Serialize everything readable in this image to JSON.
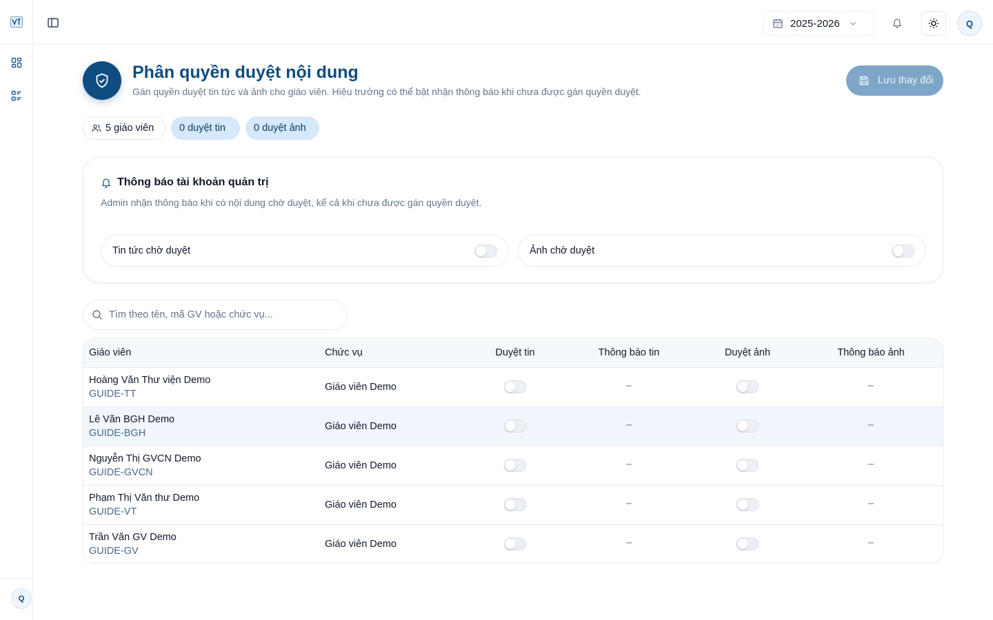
{
  "topbar": {
    "year": "2025-2026",
    "avatar_initial": "Q"
  },
  "sidebar": {
    "avatar_initial": "Q"
  },
  "header": {
    "title": "Phân quyền duyệt nội dung",
    "description": "Gán quyền duyệt tin tức và ảnh cho giáo viên. Hiệu trưởng có thể bật nhận thông báo khi chưa được gán quyền duyệt.",
    "save_label": "Lưu thay đổi"
  },
  "stats": {
    "teachers": "5 giáo viên",
    "news_approvers": "0 duyệt tin",
    "photo_approvers": "0 duyệt ảnh"
  },
  "notifications": {
    "title": "Thông báo tài khoản quản trị",
    "description": "Admin nhận thông báo khi có nội dung chờ duyệt, kể cả khi chưa được gán quyền duyệt.",
    "options": [
      {
        "label": "Tin tức chờ duyệt",
        "enabled": false
      },
      {
        "label": "Ảnh chờ duyệt",
        "enabled": false
      }
    ]
  },
  "search": {
    "placeholder": "Tìm theo tên, mã GV hoặc chức vụ..."
  },
  "table": {
    "headers": [
      "Giáo viên",
      "Chức vụ",
      "Duyệt tin",
      "Thông báo tin",
      "Duyệt ảnh",
      "Thông báo ảnh"
    ],
    "rows": [
      {
        "name": "Hoàng Văn Thư viện Demo",
        "code": "GUIDE-TT",
        "role": "Giáo viên Demo",
        "news_approve": false,
        "news_notify": "–",
        "photo_approve": false,
        "photo_notify": "–"
      },
      {
        "name": "Lê Văn BGH Demo",
        "code": "GUIDE-BGH",
        "role": "Giáo viên Demo",
        "news_approve": false,
        "news_notify": "–",
        "photo_approve": false,
        "photo_notify": "–"
      },
      {
        "name": "Nguyễn Thị GVCN Demo",
        "code": "GUIDE-GVCN",
        "role": "Giáo viên Demo",
        "news_approve": false,
        "news_notify": "–",
        "photo_approve": false,
        "photo_notify": "–"
      },
      {
        "name": "Phạm Thị Văn thư Demo",
        "code": "GUIDE-VT",
        "role": "Giáo viên Demo",
        "news_approve": false,
        "news_notify": "–",
        "photo_approve": false,
        "photo_notify": "–"
      },
      {
        "name": "Trần Văn GV Demo",
        "code": "GUIDE-GV",
        "role": "Giáo viên Demo",
        "news_approve": false,
        "news_notify": "–",
        "photo_approve": false,
        "photo_notify": "–"
      }
    ]
  },
  "colors": {
    "primary": "#0f4c81",
    "pill_blue": "#d6e8fb",
    "save_disabled": "#7fa6c8"
  }
}
